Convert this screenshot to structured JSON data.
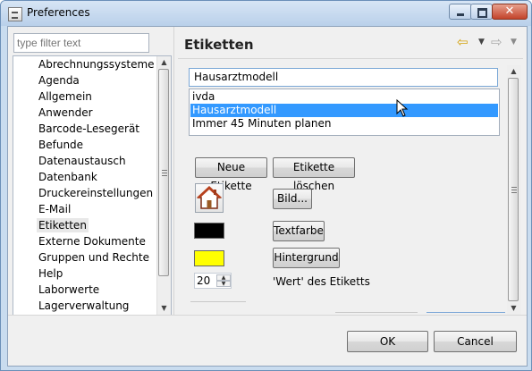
{
  "window": {
    "title": "Preferences",
    "close_symbol": "✕"
  },
  "filter": {
    "placeholder": "type filter text"
  },
  "tree": {
    "items": [
      "Abrechnungssysteme",
      "Agenda",
      "Allgemein",
      "Anwender",
      "Barcode-Lesegerät",
      "Befunde",
      "Datenaustausch",
      "Datenbank",
      "Druckereinstellungen",
      "E-Mail",
      "Etiketten",
      "Externe Dokumente",
      "Gruppen und Rechte",
      "Help",
      "Laborwerte",
      "Lagerverwaltung"
    ],
    "selected": "Etiketten"
  },
  "page": {
    "title": "Etiketten"
  },
  "etiketten": {
    "combo_value": "Hausarztmodell",
    "list": [
      "ivda",
      "Hausarztmodell",
      "Immer 45 Minuten planen"
    ],
    "selected_item": "Hausarztmodell",
    "new_label": "Neue Etikette",
    "delete_label": "Etikette löschen",
    "image_label": "Bild...",
    "text_color_label": "Textfarbe",
    "background_label": "Hintergrund",
    "text_color": "#000000",
    "background_color": "#ffff00",
    "value": "20",
    "value_label": "'Wert' des Etiketts"
  },
  "footer": {
    "ok_label": "OK",
    "cancel_label": "Cancel"
  },
  "icons": {
    "title": "preferences-icon",
    "back": "back-arrow-icon",
    "forward": "forward-arrow-icon",
    "image": "house-icon"
  }
}
